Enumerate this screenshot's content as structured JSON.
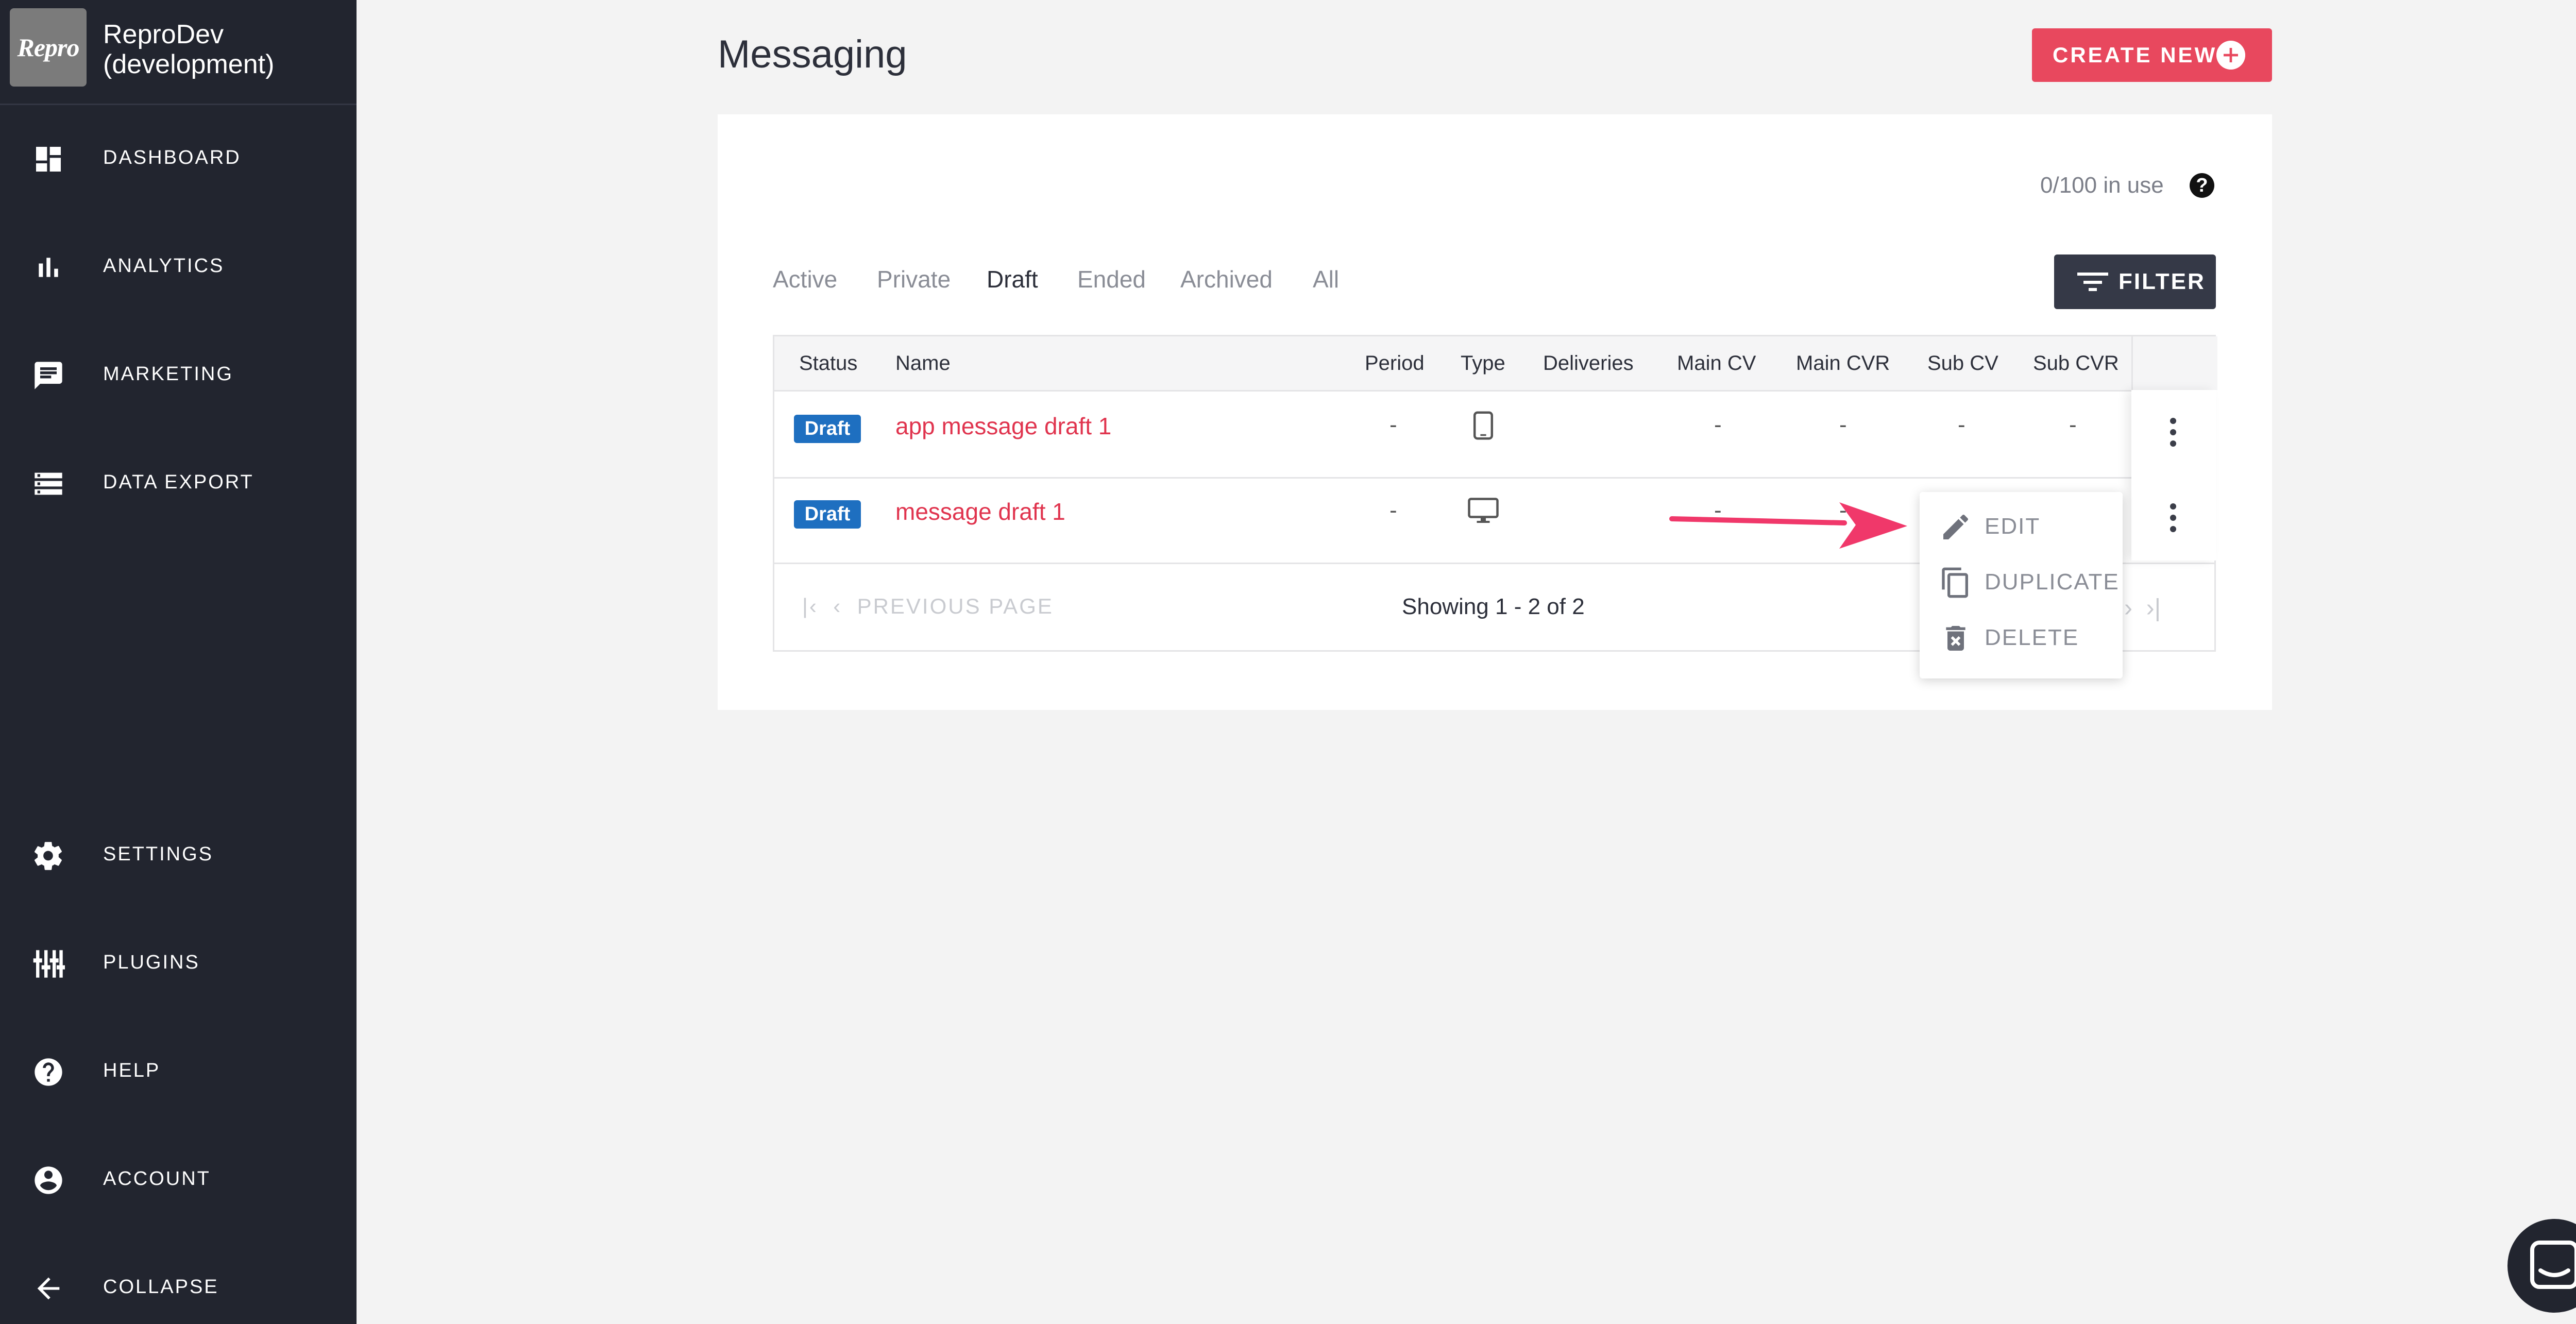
{
  "app": {
    "logo_text": "Repro",
    "name_line1": "ReproDev",
    "name_line2": "(development)"
  },
  "sidebar": {
    "items": [
      {
        "label": "DASHBOARD",
        "icon": "dashboard-icon"
      },
      {
        "label": "ANALYTICS",
        "icon": "bar-chart-icon"
      },
      {
        "label": "MARKETING",
        "icon": "chat-bubble-icon"
      },
      {
        "label": "DATA EXPORT",
        "icon": "storage-icon"
      }
    ],
    "bottom_items": [
      {
        "label": "SETTINGS",
        "icon": "gear-icon"
      },
      {
        "label": "PLUGINS",
        "icon": "sliders-icon"
      },
      {
        "label": "HELP",
        "icon": "help-icon"
      },
      {
        "label": "ACCOUNT",
        "icon": "account-icon"
      },
      {
        "label": "COLLAPSE",
        "icon": "arrow-left-icon"
      }
    ]
  },
  "header": {
    "title": "Messaging",
    "create_label": "CREATE NEW"
  },
  "usage": {
    "text": "0/100 in use",
    "help_symbol": "?"
  },
  "tabs": [
    {
      "label": "Active"
    },
    {
      "label": "Private"
    },
    {
      "label": "Draft",
      "active": true
    },
    {
      "label": "Ended"
    },
    {
      "label": "Archived"
    },
    {
      "label": "All"
    }
  ],
  "filter_label": "FILTER",
  "table": {
    "columns": [
      "Status",
      "Name",
      "Period",
      "Type",
      "Deliveries",
      "Main CV",
      "Main CVR",
      "Sub CV",
      "Sub CVR"
    ],
    "rows": [
      {
        "status": "Draft",
        "name": "app message draft 1",
        "period": "-",
        "type": "mobile-icon",
        "main_cv": "-",
        "main_cvr": "-",
        "sub_cv": "-",
        "sub_cvr": "-"
      },
      {
        "status": "Draft",
        "name": "message draft 1",
        "period": "-",
        "type": "desktop-icon",
        "main_cv": "-",
        "main_cvr": "-",
        "sub_cv": "-",
        "sub_cvr": "-"
      }
    ],
    "pagination": {
      "previous_label": "PREVIOUS PAGE",
      "showing": "Showing 1 - 2 of 2"
    }
  },
  "context_menu": {
    "items": [
      {
        "label": "EDIT",
        "icon": "pencil-icon"
      },
      {
        "label": "DUPLICATE",
        "icon": "copy-icon"
      },
      {
        "label": "DELETE",
        "icon": "trash-icon"
      }
    ]
  },
  "colors": {
    "sidebar_bg": "#22252f",
    "accent": "#e8485e",
    "draft_badge": "#1e6fc0",
    "link": "#e0344e",
    "annotation_arrow": "#f0386a"
  }
}
